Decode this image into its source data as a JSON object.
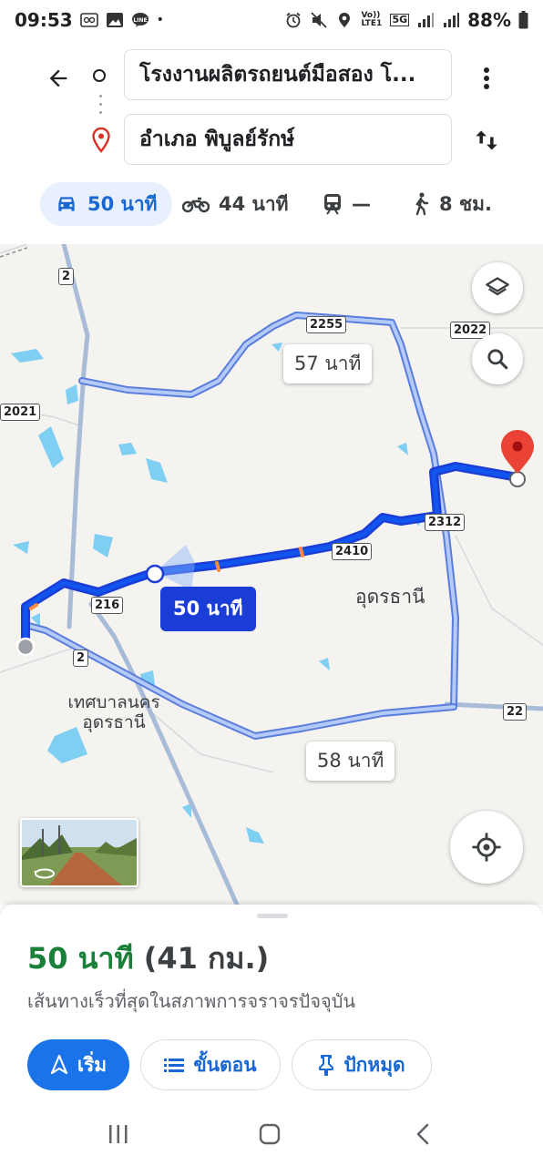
{
  "status_bar": {
    "time": "09:53",
    "dot": "•",
    "notification_icons": [
      "voicemail-icon",
      "gallery-icon",
      "line-app-icon"
    ],
    "system_icons": [
      "alarm-icon",
      "mute-icon",
      "location-icon",
      "volte-icon",
      "5g-icon",
      "signal-icon",
      "signal-icon"
    ],
    "volte_text": "Vo)) LTE1",
    "network": "5G",
    "battery": "88%"
  },
  "directions": {
    "origin": "โรงงานผลิตรถยนต์มือสอง โ...",
    "destination": "อำเภอ พิบูลย์รักษ์"
  },
  "travel_modes": [
    {
      "icon": "car-icon",
      "label": "50 นาที",
      "active": true
    },
    {
      "icon": "motorcycle-icon",
      "label": "44 นาที",
      "active": false
    },
    {
      "icon": "transit-icon",
      "label": "—",
      "active": false
    },
    {
      "icon": "walk-icon",
      "label": "8 ชม.",
      "active": false
    }
  ],
  "map": {
    "route_color": "#1a3dd8",
    "alt_route_color": "#8ab4f8",
    "road_shields": [
      "2",
      "2255",
      "2022",
      "2021",
      "2312",
      "2410",
      "216",
      "2",
      "22"
    ],
    "place_labels": [
      "อุดรธานี",
      "เทศบาลนคร",
      "อุดรธานี"
    ],
    "alt_route_times": [
      "57 นาที",
      "58 นาที"
    ],
    "main_route_time": "50 นาที"
  },
  "route_summary": {
    "duration": "50 นาที",
    "distance": "(41 กม.)",
    "description": "เส้นทางเร็วที่สุดในสภาพการจราจรปัจจุบัน",
    "duration_color": "#188038"
  },
  "actions": {
    "start": "เริ่ม",
    "steps": "ขั้นตอน",
    "pin": "ปักหมุด"
  }
}
